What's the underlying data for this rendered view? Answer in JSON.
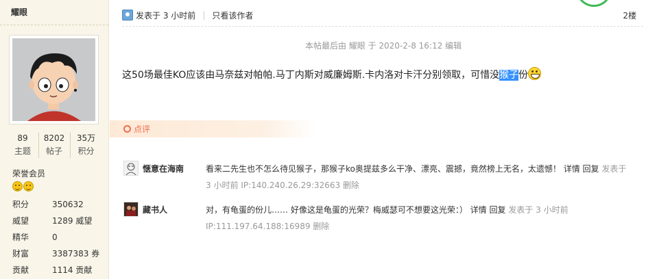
{
  "sidebar": {
    "username": "耀眼",
    "stats": [
      {
        "num": "89",
        "label": "主题"
      },
      {
        "num": "8202",
        "label": "帖子"
      },
      {
        "num": "35万",
        "label": "积分"
      }
    ],
    "group": "荣誉会员",
    "info": [
      {
        "key": "积分",
        "value": "350632"
      },
      {
        "key": "威望",
        "value": "1289 威望"
      },
      {
        "key": "精华",
        "value": "0"
      },
      {
        "key": "财富",
        "value": "3387383 券"
      },
      {
        "key": "贡献",
        "value": "1114 贡献"
      }
    ]
  },
  "post": {
    "posted_at": "发表于 3 小时前",
    "only_author": "只看该作者",
    "floor": "2楼",
    "edit_note": "本帖最后由 耀眼 于 2020-2-8 16:12 编辑",
    "body_before": "这50场最佳KO应该由马奈兹对帕帕.马丁内斯对威廉姆斯.卡内洛对卡汗分别领取，可惜没",
    "body_highlight": "猴子",
    "body_after": "份"
  },
  "comments_section": {
    "title": "点评",
    "comments": [
      {
        "user": "惬意在海南",
        "text": "看来二先生也不怎么待见猴子，那猴子ko奥提兹多么干净、漂亮、震撼，竟然榜上无名，太遗憾！",
        "detail": "详情",
        "reply": "回复",
        "meta": "发表于 3 小时前 IP:140.240.26.29:32663",
        "delete": "删除"
      },
      {
        "user": "藏书人",
        "text": "对，有龟蛋的份儿…… 好像这是龟蛋的光荣？梅威瑟可不想要这光荣：）",
        "detail": "详情",
        "reply": "回复",
        "meta": "发表于 3 小时前 IP:111.197.64.188:16989",
        "delete": "删除"
      }
    ]
  }
}
